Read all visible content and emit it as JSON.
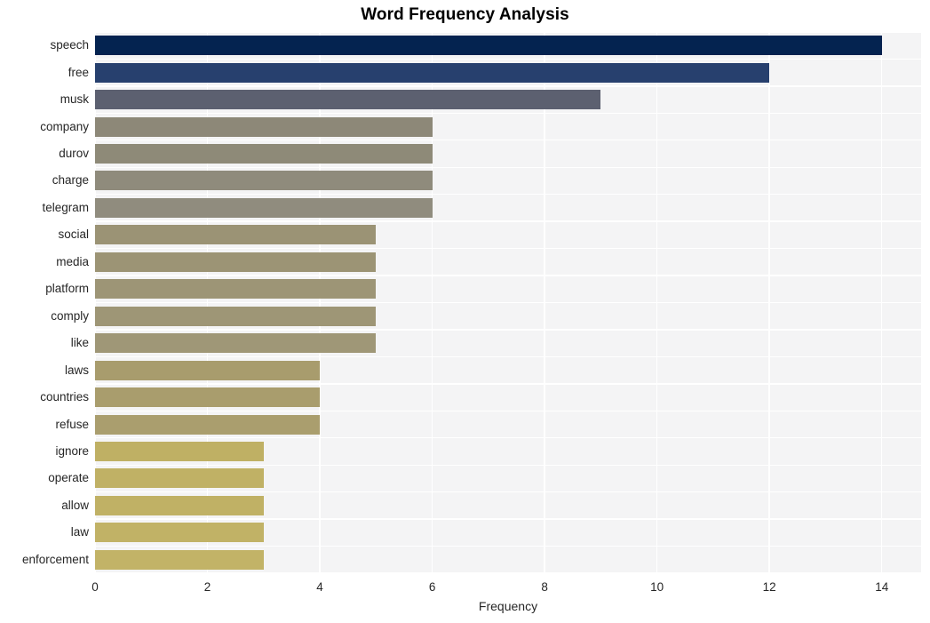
{
  "chart_data": {
    "type": "bar",
    "orientation": "horizontal",
    "title": "Word Frequency Analysis",
    "xlabel": "Frequency",
    "ylabel": "",
    "xlim": [
      0,
      14.7
    ],
    "xticks": [
      0,
      2,
      4,
      6,
      8,
      10,
      12,
      14
    ],
    "xtick_labels": [
      "0",
      "2",
      "4",
      "6",
      "8",
      "10",
      "12",
      "14"
    ],
    "grid": true,
    "legend": "none",
    "background": "#f4f4f5",
    "gridline_color": "#ffffff",
    "categories": [
      "speech",
      "free",
      "musk",
      "company",
      "durov",
      "charge",
      "telegram",
      "social",
      "media",
      "platform",
      "comply",
      "like",
      "laws",
      "countries",
      "refuse",
      "ignore",
      "operate",
      "allow",
      "law",
      "enforcement"
    ],
    "values": [
      14,
      12,
      9,
      6,
      6,
      6,
      6,
      5,
      5,
      5,
      5,
      5,
      4,
      4,
      4,
      3,
      3,
      3,
      3,
      3
    ],
    "bar_colors": [
      "#042350",
      "#27406e",
      "#5c6070",
      "#8d8878",
      "#8e8a78",
      "#8f8b7c",
      "#908c7e",
      "#9b9375",
      "#9c9475",
      "#9d9576",
      "#9e9676",
      "#9f9777",
      "#a89c6d",
      "#a99d6d",
      "#aa9e6e",
      "#bfb064",
      "#c0b165",
      "#c0b165",
      "#c1b266",
      "#c2b367"
    ]
  }
}
